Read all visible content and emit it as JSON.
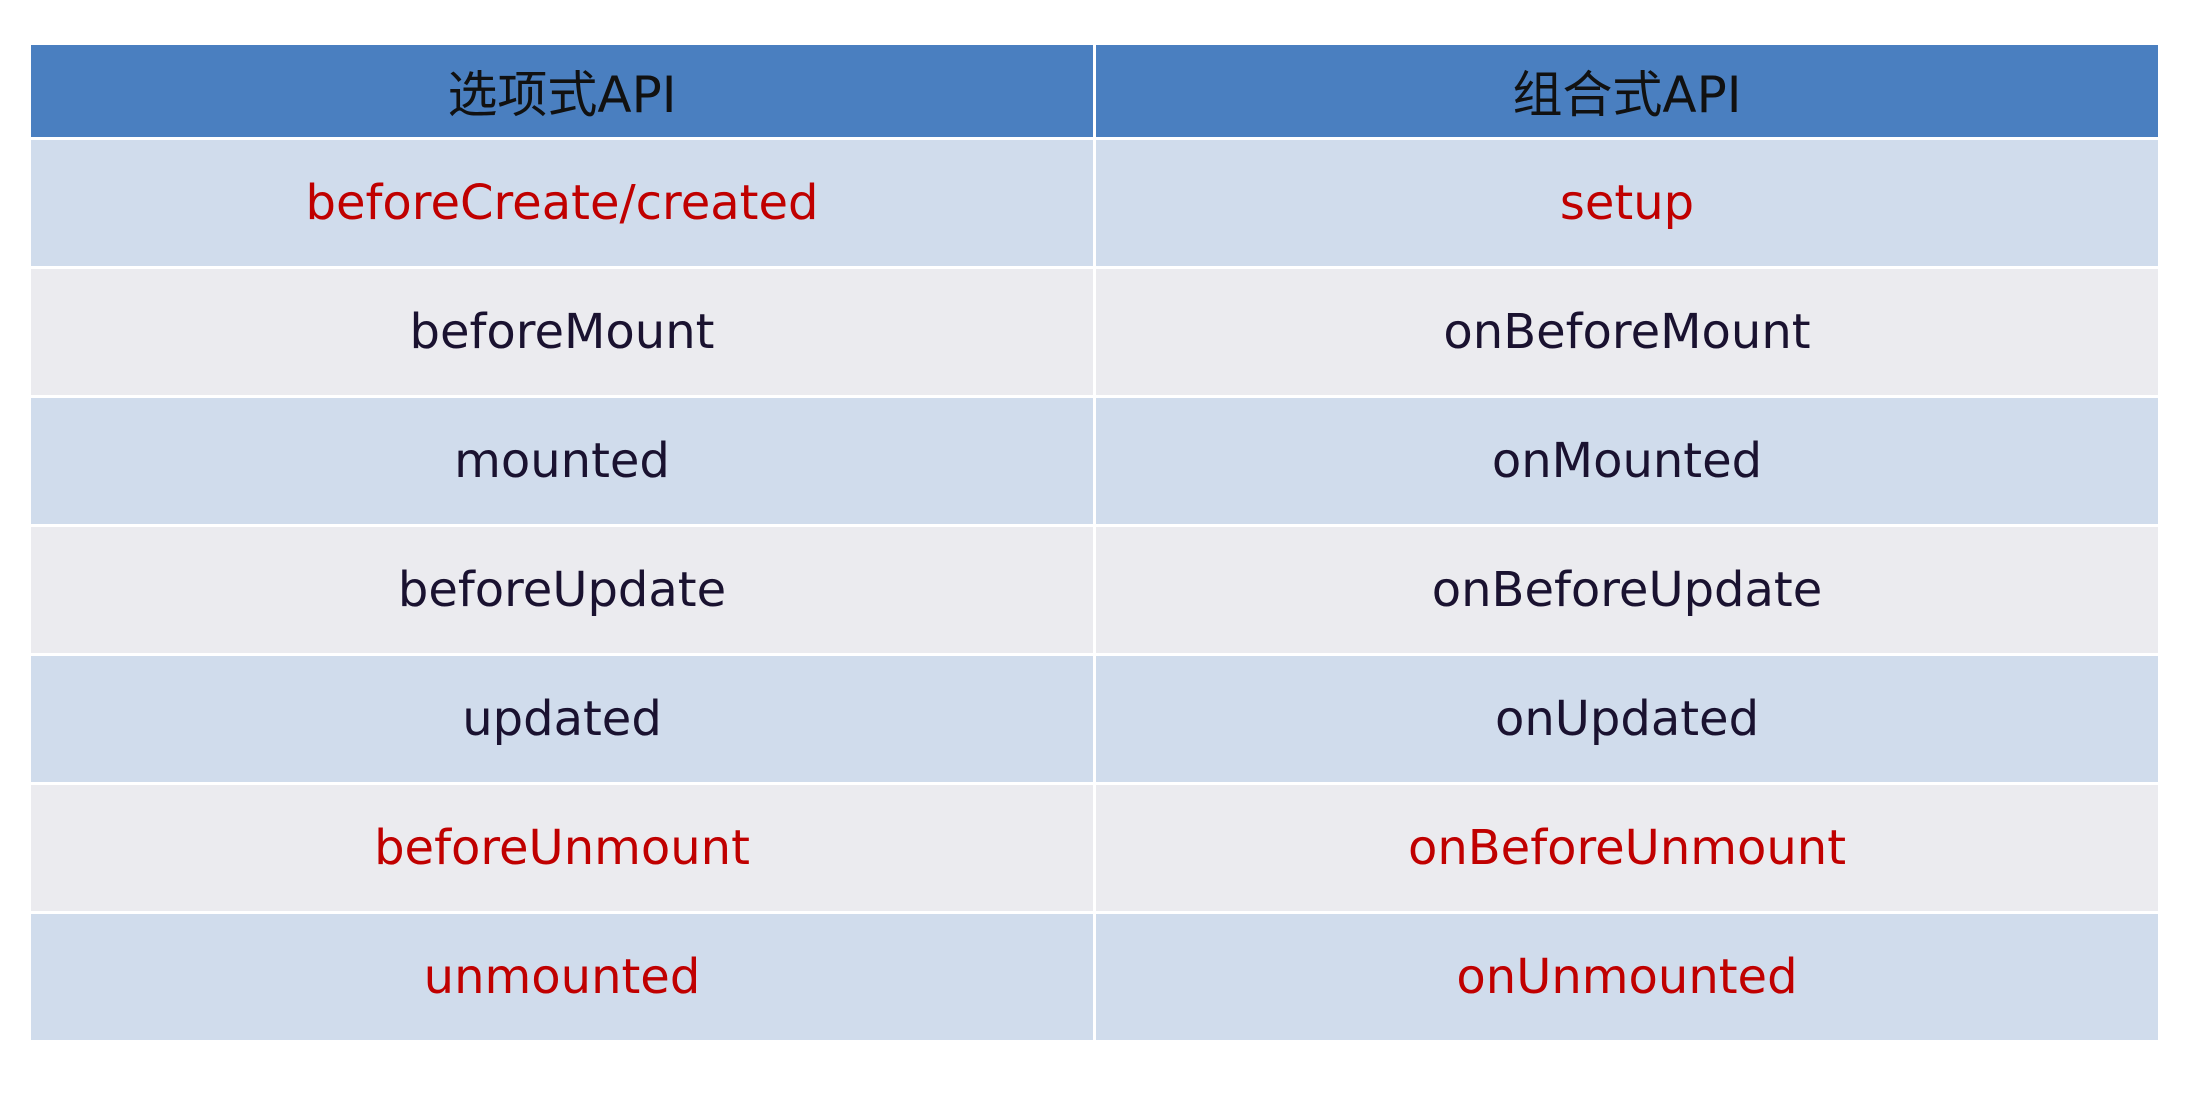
{
  "table": {
    "headers": [
      "选项式API",
      "组合式API"
    ],
    "rows": [
      {
        "options": "beforeCreate/created",
        "composition": "setup",
        "highlight": true
      },
      {
        "options": "beforeMount",
        "composition": "onBeforeMount",
        "highlight": false
      },
      {
        "options": "mounted",
        "composition": "onMounted",
        "highlight": false
      },
      {
        "options": "beforeUpdate",
        "composition": "onBeforeUpdate",
        "highlight": false
      },
      {
        "options": "updated",
        "composition": "onUpdated",
        "highlight": false
      },
      {
        "options": "beforeUnmount",
        "composition": "onBeforeUnmount",
        "highlight": true
      },
      {
        "options": "unmounted",
        "composition": "onUnmounted",
        "highlight": true
      }
    ]
  },
  "colors": {
    "header_bg": "#4a7fc0",
    "row_alt_bg": "#d0dcec",
    "row_bg": "#ebebef",
    "highlight_text": "#c00000",
    "normal_text": "#1a1230"
  }
}
